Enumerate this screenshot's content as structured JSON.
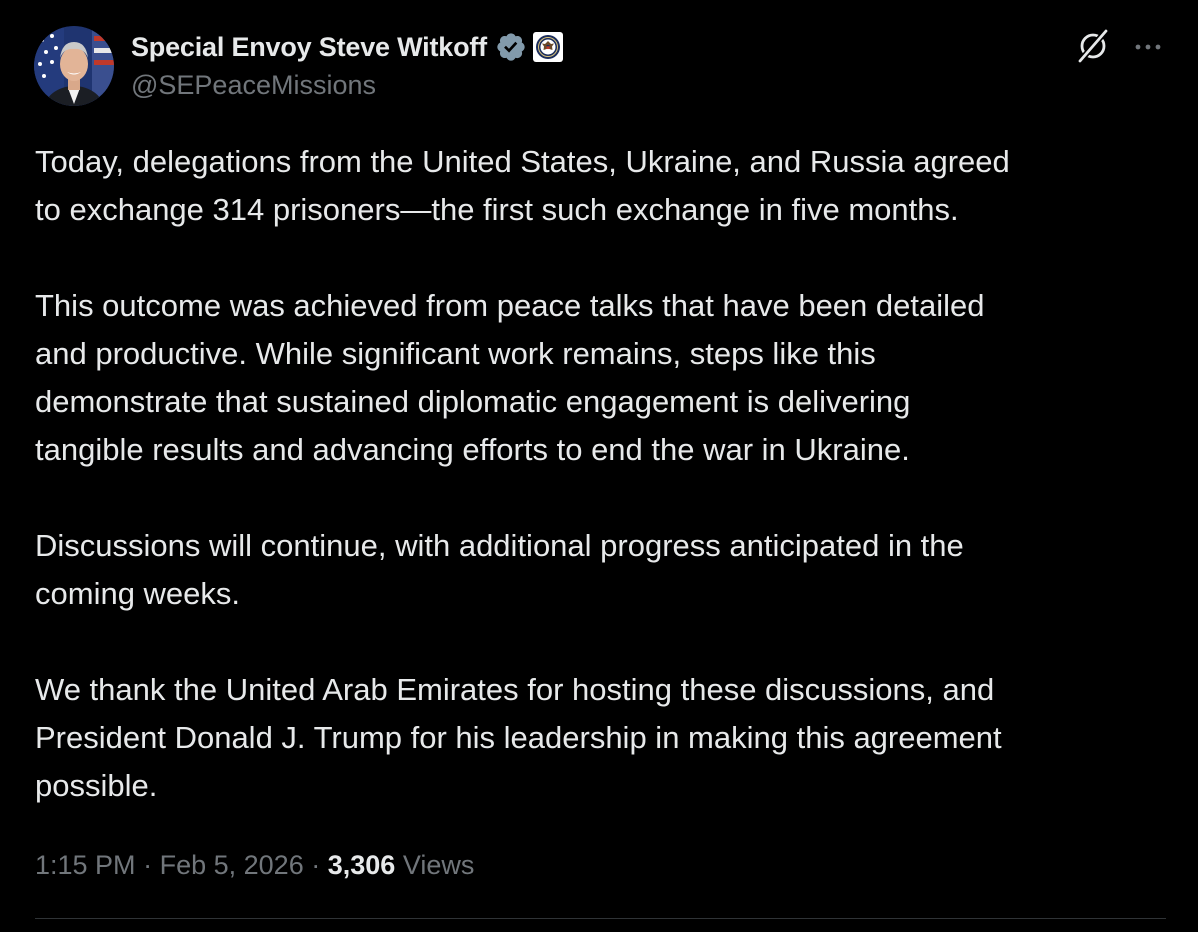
{
  "author": {
    "display_name": "Special Envoy Steve Witkoff",
    "handle": "@SEPeaceMissions",
    "verified": true,
    "verified_badge_color": "#829aab",
    "affiliation_badge": "seal-icon"
  },
  "post": {
    "paragraphs": [
      "Today, delegations from the United States, Ukraine, and Russia agreed\nto exchange 314 prisoners—the first such exchange in five months.",
      "This outcome was achieved from peace talks that have been detailed\nand productive. While significant work remains, steps like this\ndemonstrate that sustained diplomatic engagement is delivering\ntangible results and advancing efforts to end the war in Ukraine.",
      "Discussions will continue, with additional progress anticipated in the\ncoming weeks.",
      "We thank the United Arab Emirates for hosting these discussions, and\nPresident Donald J. Trump for his leadership in making this agreement\npossible."
    ],
    "time": "1:15 PM",
    "date": "Feb 5, 2026",
    "separator": "·",
    "views_count": "3,306",
    "views_label": "Views"
  },
  "actions": {
    "grok_icon": "grok-icon",
    "more_icon": "more-icon"
  },
  "colors": {
    "background": "#000000",
    "text_primary": "#e7e9ea",
    "text_secondary": "#71767b",
    "divider": "#2f3336"
  }
}
